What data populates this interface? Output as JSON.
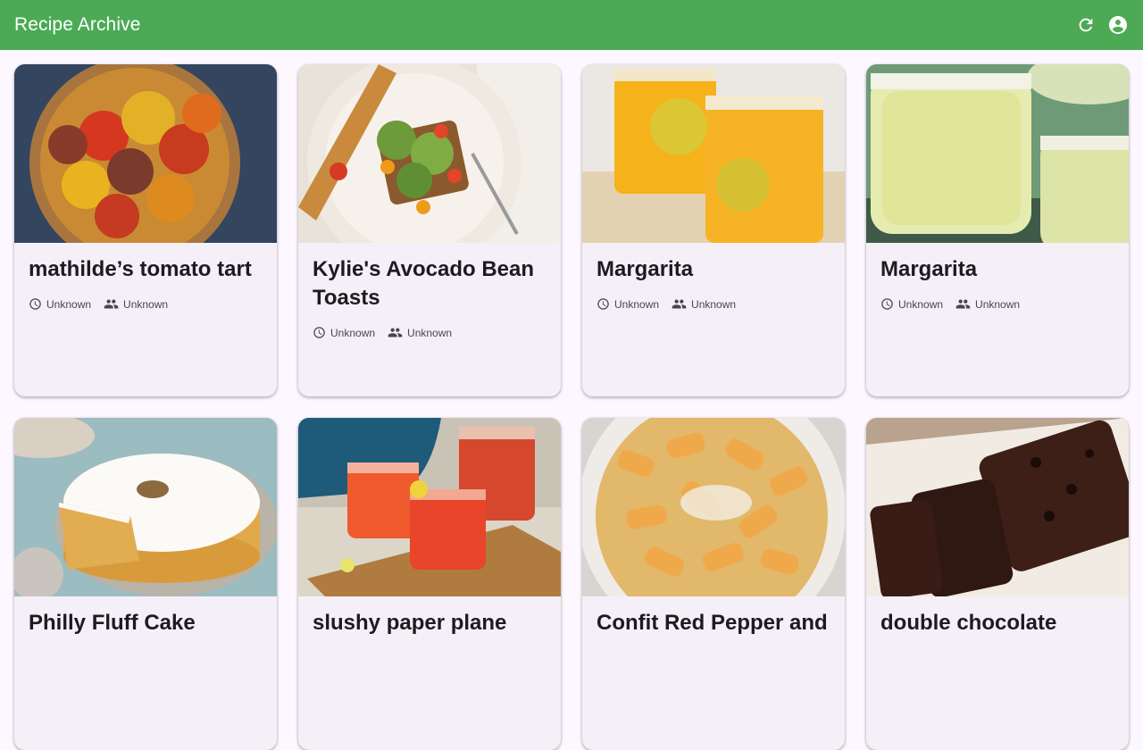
{
  "appbar": {
    "title": "Recipe Archive",
    "refresh_icon": "refresh-icon",
    "account_icon": "account-circle-icon"
  },
  "colors": {
    "appbar": "#4caa55",
    "background": "#fdf7ff",
    "card": "#f5eff7"
  },
  "recipes": [
    {
      "title": "mathilde’s tomato tart",
      "time": "Unknown",
      "servings": "Unknown",
      "image": "tomato-tart-photo"
    },
    {
      "title": "Kylie's Avocado Bean Toasts",
      "time": "Unknown",
      "servings": "Unknown",
      "image": "avocado-toast-photo"
    },
    {
      "title": "Margarita",
      "time": "Unknown",
      "servings": "Unknown",
      "image": "orange-margarita-photo"
    },
    {
      "title": "Margarita",
      "time": "Unknown",
      "servings": "Unknown",
      "image": "lime-margarita-photo"
    },
    {
      "title": "Philly Fluff Cake",
      "image": "fluff-cake-photo"
    },
    {
      "title": "slushy paper plane",
      "image": "paper-plane-cocktail-photo"
    },
    {
      "title": "Confit Red Pepper and",
      "image": "pepper-pasta-photo"
    },
    {
      "title": "double chocolate",
      "image": "chocolate-loaf-photo"
    }
  ]
}
